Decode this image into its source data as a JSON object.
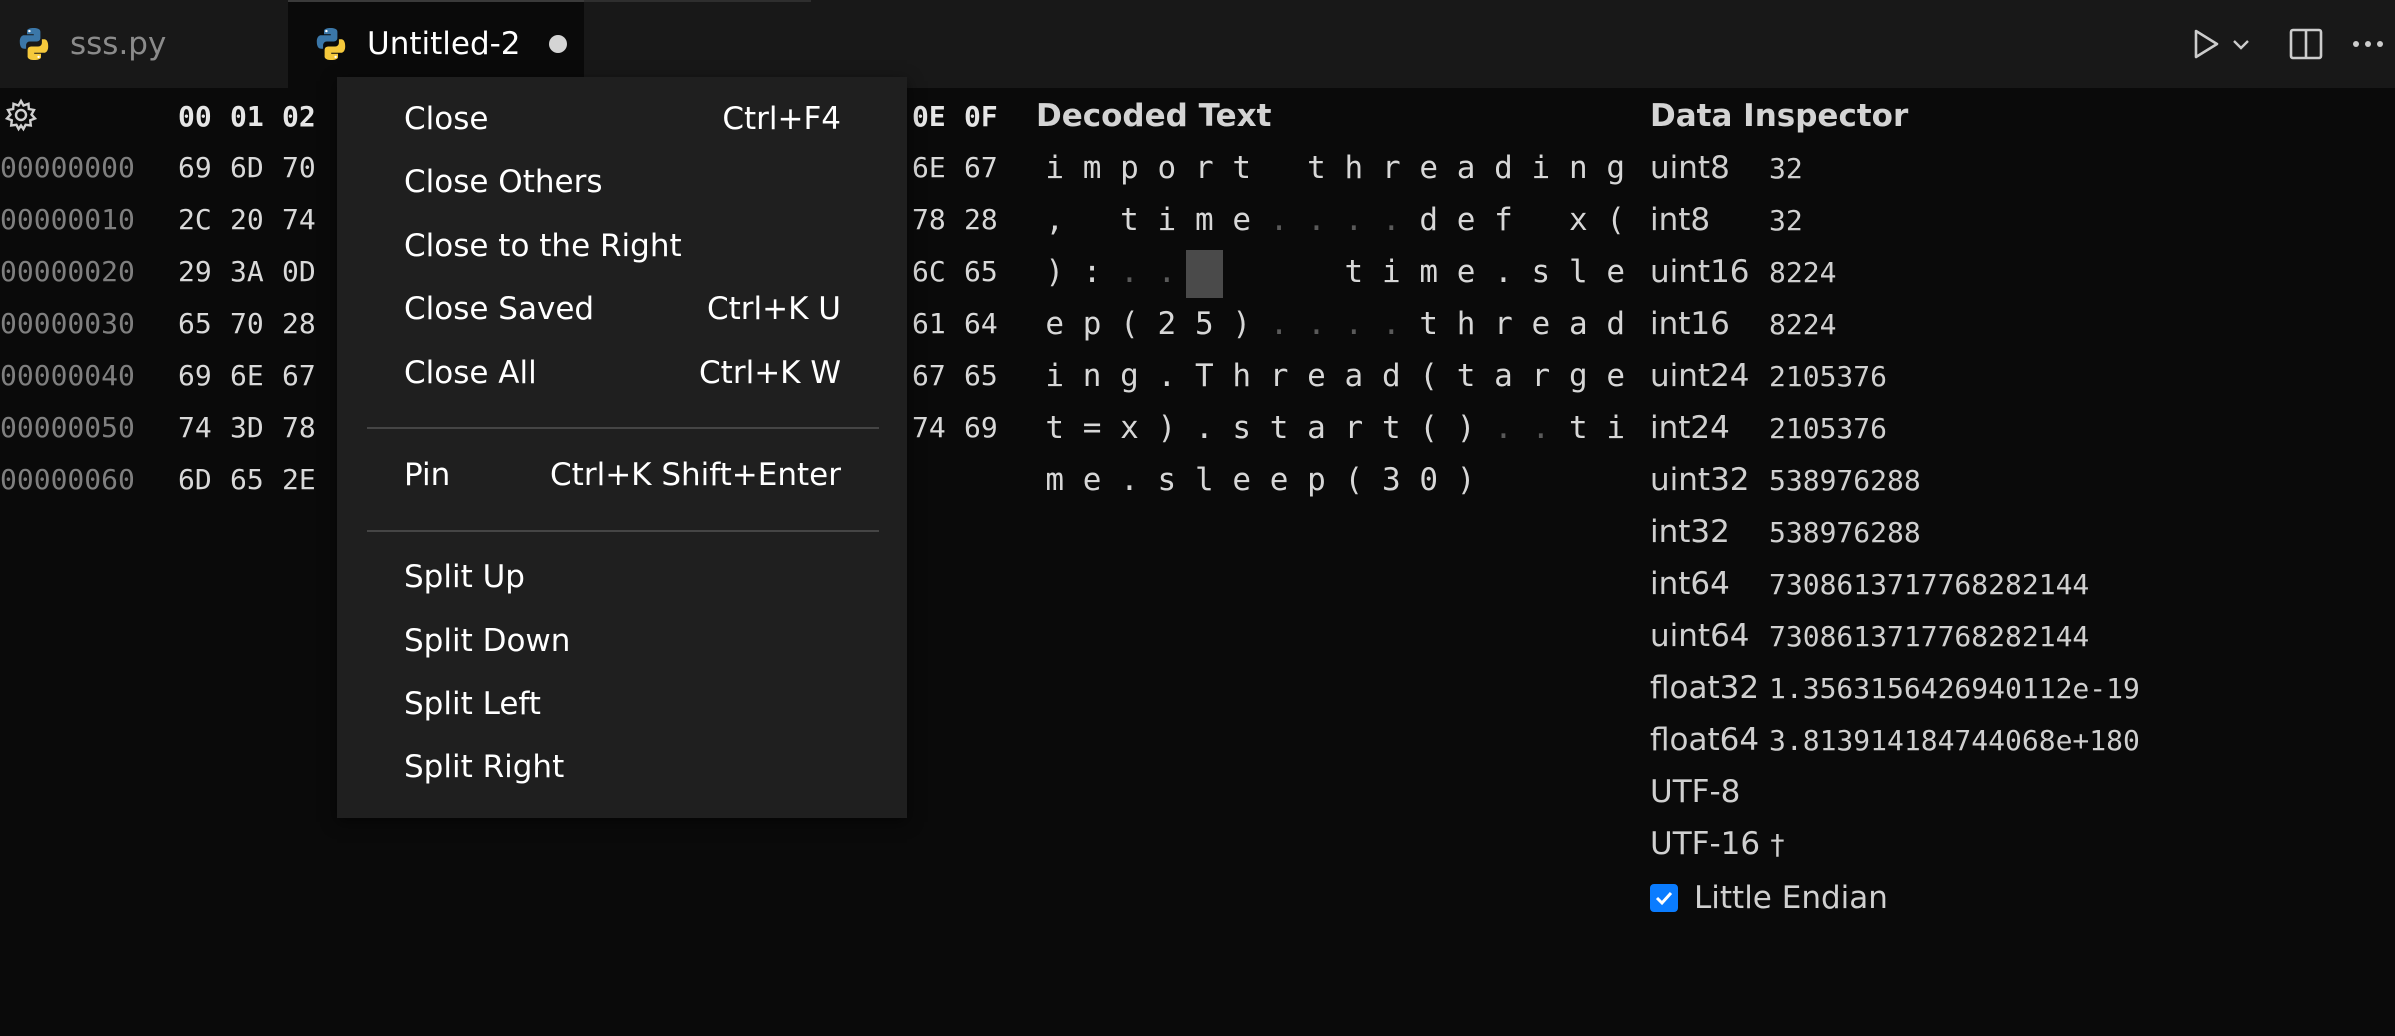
{
  "tabs": [
    {
      "label": "sss.py",
      "icon": "python-icon",
      "active": false
    },
    {
      "label": "Untitled-2",
      "icon": "python-icon",
      "active": true,
      "dirty": true
    }
  ],
  "toolbar": {
    "run_icon": "play-icon",
    "run_dropdown_icon": "chevron-down-icon",
    "split_icon": "split-editor-icon",
    "more_icon": "ellipsis-icon"
  },
  "hex": {
    "settings_icon": "gear-icon",
    "header_left": [
      "00",
      "01",
      "02"
    ],
    "header_right": [
      "0E",
      "0F"
    ],
    "rows": [
      {
        "addr": "00000000",
        "left": [
          "69",
          "6D",
          "70"
        ],
        "right": [
          "6E",
          "67"
        ]
      },
      {
        "addr": "00000010",
        "left": [
          "2C",
          "20",
          "74"
        ],
        "right": [
          "78",
          "28"
        ]
      },
      {
        "addr": "00000020",
        "left": [
          "29",
          "3A",
          "0D"
        ],
        "right": [
          "6C",
          "65"
        ]
      },
      {
        "addr": "00000030",
        "left": [
          "65",
          "70",
          "28"
        ],
        "right": [
          "61",
          "64"
        ]
      },
      {
        "addr": "00000040",
        "left": [
          "69",
          "6E",
          "67"
        ],
        "right": [
          "67",
          "65"
        ]
      },
      {
        "addr": "00000050",
        "left": [
          "74",
          "3D",
          "78"
        ],
        "right": [
          "74",
          "69"
        ]
      },
      {
        "addr": "00000060",
        "left": [
          "6D",
          "65",
          "2E"
        ],
        "right": []
      }
    ]
  },
  "decoded": {
    "title": "Decoded Text",
    "rows": [
      [
        "i",
        "m",
        "p",
        "o",
        "r",
        "t",
        " ",
        "t",
        "h",
        "r",
        "e",
        "a",
        "d",
        "i",
        "n",
        "g"
      ],
      [
        ",",
        " ",
        "t",
        "i",
        "m",
        "e",
        ".",
        ".",
        ".",
        ".",
        "d",
        "e",
        "f",
        " ",
        "x",
        "("
      ],
      [
        ")",
        ":",
        ".",
        ".",
        " ",
        " ",
        " ",
        " ",
        "t",
        "i",
        "m",
        "e",
        ".",
        "s",
        "l",
        "e"
      ],
      [
        "e",
        "p",
        "(",
        "2",
        "5",
        ")",
        ".",
        ".",
        ".",
        ".",
        "t",
        "h",
        "r",
        "e",
        "a",
        "d"
      ],
      [
        "i",
        "n",
        "g",
        ".",
        "T",
        "h",
        "r",
        "e",
        "a",
        "d",
        "(",
        "t",
        "a",
        "r",
        "g",
        "e"
      ],
      [
        "t",
        "=",
        "x",
        ")",
        ".",
        "s",
        "t",
        "a",
        "r",
        "t",
        "(",
        ")",
        ".",
        ".",
        "t",
        "i"
      ],
      [
        "m",
        "e",
        ".",
        "s",
        "l",
        "e",
        "e",
        "p",
        "(",
        "3",
        "0",
        ")"
      ]
    ],
    "dim_cells": [
      "1-6",
      "1-7",
      "1-8",
      "1-9",
      "2-2",
      "2-3",
      "3-6",
      "3-7",
      "3-8",
      "3-9",
      "5-12",
      "5-13"
    ],
    "selected_cell": "2-4"
  },
  "inspector": {
    "title": "Data Inspector",
    "rows": [
      {
        "label": "uint8",
        "value": "32"
      },
      {
        "label": "int8",
        "value": "32"
      },
      {
        "label": "uint16",
        "value": "8224"
      },
      {
        "label": "int16",
        "value": "8224"
      },
      {
        "label": "uint24",
        "value": "2105376"
      },
      {
        "label": "int24",
        "value": "2105376"
      },
      {
        "label": "uint32",
        "value": "538976288"
      },
      {
        "label": "int32",
        "value": "538976288"
      },
      {
        "label": "int64",
        "value": "7308613717768282144"
      },
      {
        "label": "uint64",
        "value": "7308613717768282144"
      },
      {
        "label": "float32",
        "value": "1.3563156426940112e-19"
      },
      {
        "label": "float64",
        "value": "3.813914184744068e+180"
      },
      {
        "label": "UTF-8",
        "value": ""
      },
      {
        "label": "UTF-16",
        "value": "†"
      }
    ],
    "little_endian_label": "Little Endian",
    "little_endian_checked": true
  },
  "context_menu": {
    "groups": [
      [
        {
          "label": "Close",
          "shortcut": "Ctrl+F4"
        },
        {
          "label": "Close Others",
          "shortcut": ""
        },
        {
          "label": "Close to the Right",
          "shortcut": ""
        },
        {
          "label": "Close Saved",
          "shortcut": "Ctrl+K U"
        },
        {
          "label": "Close All",
          "shortcut": "Ctrl+K W"
        }
      ],
      [
        {
          "label": "Pin",
          "shortcut": "Ctrl+K Shift+Enter"
        }
      ],
      [
        {
          "label": "Split Up",
          "shortcut": ""
        },
        {
          "label": "Split Down",
          "shortcut": ""
        },
        {
          "label": "Split Left",
          "shortcut": ""
        },
        {
          "label": "Split Right",
          "shortcut": ""
        }
      ]
    ]
  }
}
